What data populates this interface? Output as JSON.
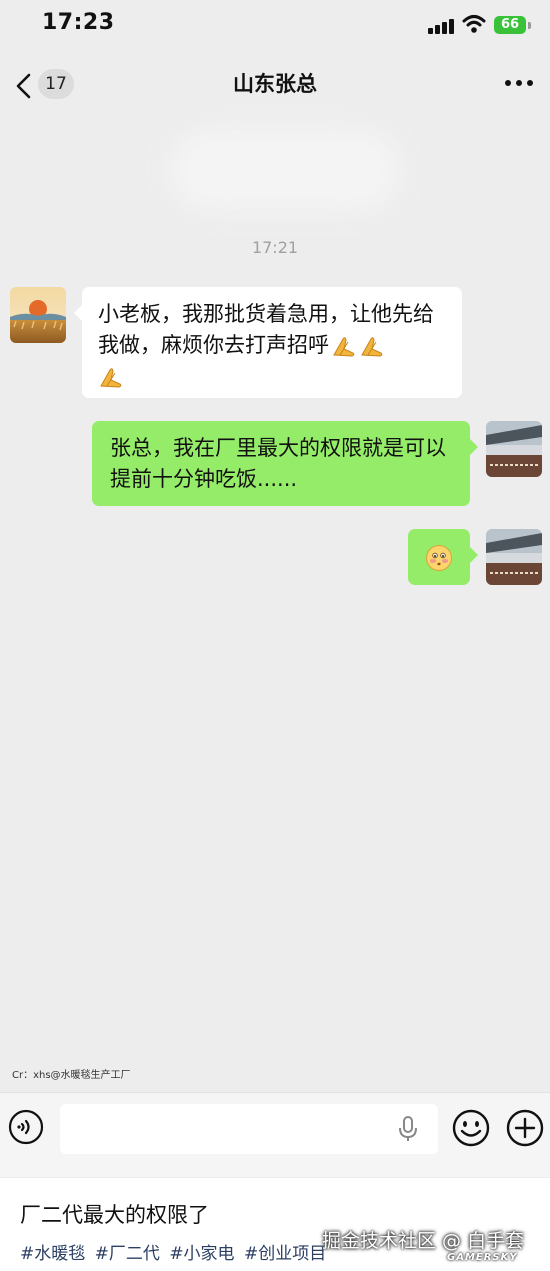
{
  "status_bar": {
    "time": "17:23",
    "battery": "66"
  },
  "header": {
    "unread_count": "17",
    "title": "山东张总"
  },
  "chat": {
    "timestamp": "17:21",
    "messages": [
      {
        "sender": "contact",
        "text": "小老板，我那批货着急用，让他先给我做，麻烦你去打声招呼",
        "emoji": "pray-emoji"
      },
      {
        "sender": "me",
        "text": "张总，我在厂里最大的权限就是可以提前十分钟吃饭......"
      },
      {
        "sender": "me",
        "emoji": "shy-emoji"
      }
    ]
  },
  "credit": "Cr：xhs@水暖毯生产工厂",
  "input": {
    "placeholder": ""
  },
  "post": {
    "title": "厂二代最大的权限了",
    "tags": [
      "#水暖毯",
      "#厂二代",
      "#小家电",
      "#创业项目"
    ]
  },
  "watermark": {
    "text": "掘金技术社区 @ 白手套",
    "brand": "GAMERSKY"
  },
  "colors": {
    "chat_bg": "#ededed",
    "bubble_out": "#95ec69",
    "bubble_in": "#ffffff",
    "tag_color": "#2c3f63"
  }
}
